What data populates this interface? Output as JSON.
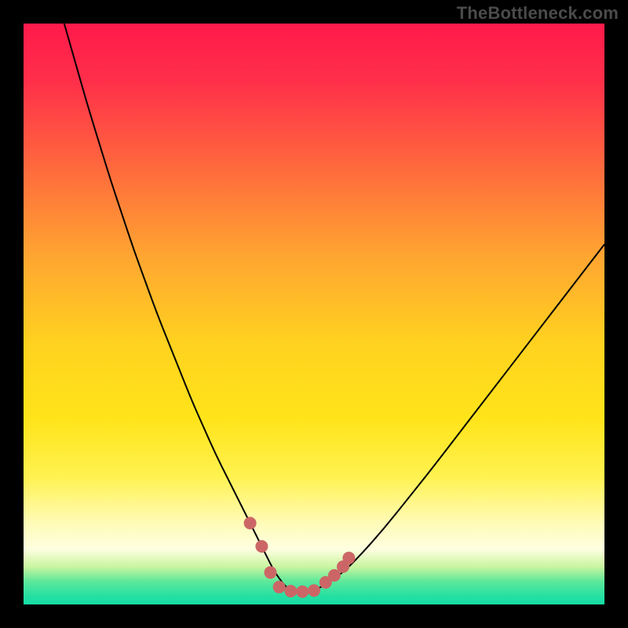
{
  "watermark": "TheBottleneck.com",
  "chart_data": {
    "type": "line",
    "title": "",
    "xlabel": "",
    "ylabel": "",
    "xlim": [
      0,
      100
    ],
    "ylim": [
      0,
      100
    ],
    "grid": false,
    "gradient_stops": [
      {
        "offset": 0.0,
        "color": "#ff1a4b"
      },
      {
        "offset": 0.1,
        "color": "#ff2f4a"
      },
      {
        "offset": 0.25,
        "color": "#ff6a3d"
      },
      {
        "offset": 0.4,
        "color": "#ffa531"
      },
      {
        "offset": 0.55,
        "color": "#ffd21f"
      },
      {
        "offset": 0.68,
        "color": "#ffe41a"
      },
      {
        "offset": 0.78,
        "color": "#fff250"
      },
      {
        "offset": 0.86,
        "color": "#fffbb8"
      },
      {
        "offset": 0.905,
        "color": "#fefee0"
      },
      {
        "offset": 0.935,
        "color": "#c9f5a0"
      },
      {
        "offset": 0.96,
        "color": "#5fe89a"
      },
      {
        "offset": 0.985,
        "color": "#25e0a2"
      },
      {
        "offset": 1.0,
        "color": "#17dda5"
      }
    ],
    "series": [
      {
        "name": "bottleneck-curve",
        "color": "#000000",
        "stroke_width": 2,
        "x": [
          7,
          9,
          11,
          13,
          15,
          17,
          19,
          21,
          23,
          25,
          27,
          29,
          31,
          33,
          35,
          37,
          39,
          40,
          41,
          42,
          43,
          44,
          45,
          46,
          48,
          50,
          52,
          55,
          58,
          62,
          66,
          70,
          75,
          80,
          85,
          90,
          95,
          100
        ],
        "y": [
          100,
          93,
          86,
          79.5,
          73,
          67,
          61,
          55.5,
          50,
          45,
          40,
          35,
          30.5,
          26,
          22,
          18,
          14,
          12,
          10,
          8,
          6,
          4.5,
          3.2,
          2.4,
          2.2,
          2.4,
          3.4,
          5.5,
          8.5,
          13,
          18,
          23,
          29.5,
          36,
          42.5,
          49,
          55.5,
          62
        ]
      }
    ],
    "markers": {
      "color": "#cc6666",
      "radius": 8,
      "points": [
        {
          "x": 39,
          "y": 14
        },
        {
          "x": 41,
          "y": 10
        },
        {
          "x": 42.5,
          "y": 5.5
        },
        {
          "x": 44,
          "y": 3
        },
        {
          "x": 46,
          "y": 2.3
        },
        {
          "x": 48,
          "y": 2.2
        },
        {
          "x": 50,
          "y": 2.4
        },
        {
          "x": 52,
          "y": 3.8
        },
        {
          "x": 53.5,
          "y": 5
        },
        {
          "x": 55,
          "y": 6.5
        },
        {
          "x": 56,
          "y": 8
        }
      ]
    }
  }
}
